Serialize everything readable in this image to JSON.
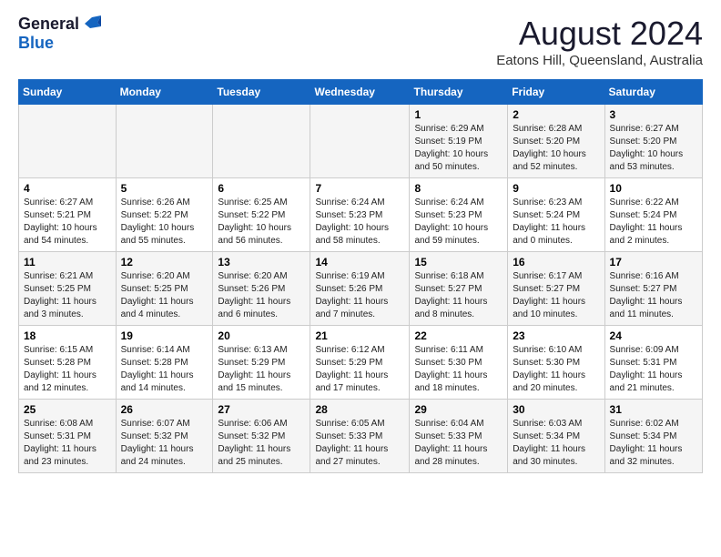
{
  "logo": {
    "general": "General",
    "blue": "Blue"
  },
  "title": "August 2024",
  "subtitle": "Eatons Hill, Queensland, Australia",
  "days_of_week": [
    "Sunday",
    "Monday",
    "Tuesday",
    "Wednesday",
    "Thursday",
    "Friday",
    "Saturday"
  ],
  "weeks": [
    [
      {
        "day": "",
        "info": ""
      },
      {
        "day": "",
        "info": ""
      },
      {
        "day": "",
        "info": ""
      },
      {
        "day": "",
        "info": ""
      },
      {
        "day": "1",
        "info": "Sunrise: 6:29 AM\nSunset: 5:19 PM\nDaylight: 10 hours\nand 50 minutes."
      },
      {
        "day": "2",
        "info": "Sunrise: 6:28 AM\nSunset: 5:20 PM\nDaylight: 10 hours\nand 52 minutes."
      },
      {
        "day": "3",
        "info": "Sunrise: 6:27 AM\nSunset: 5:20 PM\nDaylight: 10 hours\nand 53 minutes."
      }
    ],
    [
      {
        "day": "4",
        "info": "Sunrise: 6:27 AM\nSunset: 5:21 PM\nDaylight: 10 hours\nand 54 minutes."
      },
      {
        "day": "5",
        "info": "Sunrise: 6:26 AM\nSunset: 5:22 PM\nDaylight: 10 hours\nand 55 minutes."
      },
      {
        "day": "6",
        "info": "Sunrise: 6:25 AM\nSunset: 5:22 PM\nDaylight: 10 hours\nand 56 minutes."
      },
      {
        "day": "7",
        "info": "Sunrise: 6:24 AM\nSunset: 5:23 PM\nDaylight: 10 hours\nand 58 minutes."
      },
      {
        "day": "8",
        "info": "Sunrise: 6:24 AM\nSunset: 5:23 PM\nDaylight: 10 hours\nand 59 minutes."
      },
      {
        "day": "9",
        "info": "Sunrise: 6:23 AM\nSunset: 5:24 PM\nDaylight: 11 hours\nand 0 minutes."
      },
      {
        "day": "10",
        "info": "Sunrise: 6:22 AM\nSunset: 5:24 PM\nDaylight: 11 hours\nand 2 minutes."
      }
    ],
    [
      {
        "day": "11",
        "info": "Sunrise: 6:21 AM\nSunset: 5:25 PM\nDaylight: 11 hours\nand 3 minutes."
      },
      {
        "day": "12",
        "info": "Sunrise: 6:20 AM\nSunset: 5:25 PM\nDaylight: 11 hours\nand 4 minutes."
      },
      {
        "day": "13",
        "info": "Sunrise: 6:20 AM\nSunset: 5:26 PM\nDaylight: 11 hours\nand 6 minutes."
      },
      {
        "day": "14",
        "info": "Sunrise: 6:19 AM\nSunset: 5:26 PM\nDaylight: 11 hours\nand 7 minutes."
      },
      {
        "day": "15",
        "info": "Sunrise: 6:18 AM\nSunset: 5:27 PM\nDaylight: 11 hours\nand 8 minutes."
      },
      {
        "day": "16",
        "info": "Sunrise: 6:17 AM\nSunset: 5:27 PM\nDaylight: 11 hours\nand 10 minutes."
      },
      {
        "day": "17",
        "info": "Sunrise: 6:16 AM\nSunset: 5:27 PM\nDaylight: 11 hours\nand 11 minutes."
      }
    ],
    [
      {
        "day": "18",
        "info": "Sunrise: 6:15 AM\nSunset: 5:28 PM\nDaylight: 11 hours\nand 12 minutes."
      },
      {
        "day": "19",
        "info": "Sunrise: 6:14 AM\nSunset: 5:28 PM\nDaylight: 11 hours\nand 14 minutes."
      },
      {
        "day": "20",
        "info": "Sunrise: 6:13 AM\nSunset: 5:29 PM\nDaylight: 11 hours\nand 15 minutes."
      },
      {
        "day": "21",
        "info": "Sunrise: 6:12 AM\nSunset: 5:29 PM\nDaylight: 11 hours\nand 17 minutes."
      },
      {
        "day": "22",
        "info": "Sunrise: 6:11 AM\nSunset: 5:30 PM\nDaylight: 11 hours\nand 18 minutes."
      },
      {
        "day": "23",
        "info": "Sunrise: 6:10 AM\nSunset: 5:30 PM\nDaylight: 11 hours\nand 20 minutes."
      },
      {
        "day": "24",
        "info": "Sunrise: 6:09 AM\nSunset: 5:31 PM\nDaylight: 11 hours\nand 21 minutes."
      }
    ],
    [
      {
        "day": "25",
        "info": "Sunrise: 6:08 AM\nSunset: 5:31 PM\nDaylight: 11 hours\nand 23 minutes."
      },
      {
        "day": "26",
        "info": "Sunrise: 6:07 AM\nSunset: 5:32 PM\nDaylight: 11 hours\nand 24 minutes."
      },
      {
        "day": "27",
        "info": "Sunrise: 6:06 AM\nSunset: 5:32 PM\nDaylight: 11 hours\nand 25 minutes."
      },
      {
        "day": "28",
        "info": "Sunrise: 6:05 AM\nSunset: 5:33 PM\nDaylight: 11 hours\nand 27 minutes."
      },
      {
        "day": "29",
        "info": "Sunrise: 6:04 AM\nSunset: 5:33 PM\nDaylight: 11 hours\nand 28 minutes."
      },
      {
        "day": "30",
        "info": "Sunrise: 6:03 AM\nSunset: 5:34 PM\nDaylight: 11 hours\nand 30 minutes."
      },
      {
        "day": "31",
        "info": "Sunrise: 6:02 AM\nSunset: 5:34 PM\nDaylight: 11 hours\nand 32 minutes."
      }
    ]
  ]
}
